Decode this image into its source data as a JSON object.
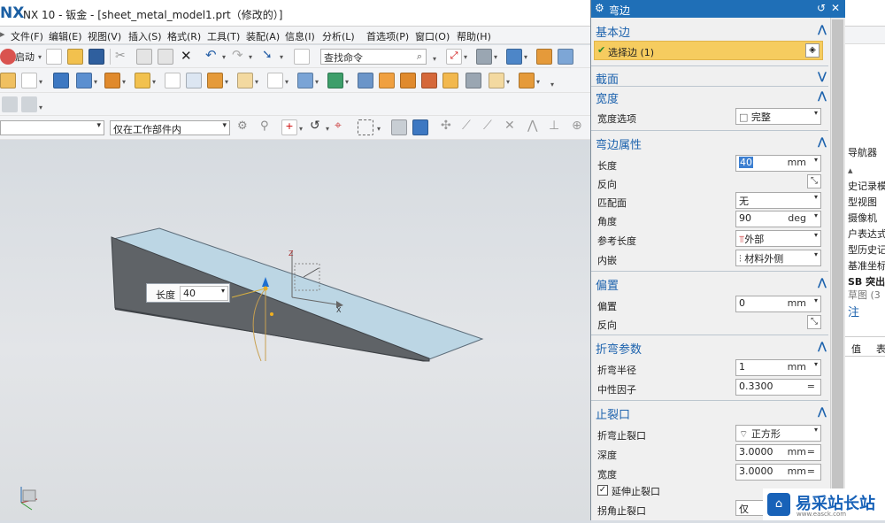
{
  "app": {
    "logo": "NX",
    "window_title": "NX 10 - 钣金 - [sheet_metal_model1.prt（修改的）]"
  },
  "menu": {
    "items": [
      "文件(F)",
      "编辑(E)",
      "视图(V)",
      "插入(S)",
      "格式(R)",
      "工具(T)",
      "装配(A)",
      "信息(I)",
      "分析(L)",
      "首选项(P)",
      "窗口(O)",
      "帮助(H)"
    ]
  },
  "toolbar": {
    "start_label": "启动",
    "search_placeholder": "查找命令",
    "filter_select": "",
    "scope_select": "仅在工作部件内"
  },
  "viewport": {
    "length_popup_label": "长度",
    "length_popup_value": "40",
    "axis_x": "X",
    "axis_z": "Z"
  },
  "dialog": {
    "title": "弯边",
    "sections": {
      "base_edge": {
        "title": "基本边",
        "select_label": "选择边 (1)"
      },
      "profile": {
        "title": "截面"
      },
      "width": {
        "title": "宽度",
        "width_option_label": "宽度选项",
        "width_option_value": "完整"
      },
      "flange_props": {
        "title": "弯边属性",
        "length_label": "长度",
        "length_value": "40",
        "length_unit": "mm",
        "reverse_label": "反向",
        "match_face_label": "匹配面",
        "match_face_value": "无",
        "angle_label": "角度",
        "angle_value": "90",
        "angle_unit": "deg",
        "ref_length_label": "参考长度",
        "ref_length_value": "外部",
        "inset_label": "内嵌",
        "inset_value": "材料外侧"
      },
      "offset": {
        "title": "偏置",
        "offset_label": "偏置",
        "offset_value": "0",
        "offset_unit": "mm",
        "reverse_label": "反向"
      },
      "bend_params": {
        "title": "折弯参数",
        "radius_label": "折弯半径",
        "radius_value": "1",
        "radius_unit": "mm",
        "neutral_label": "中性因子",
        "neutral_value": "0.3300"
      },
      "relief": {
        "title": "止裂口",
        "bend_relief_label": "折弯止裂口",
        "bend_relief_value": "正方形",
        "depth_label": "深度",
        "depth_value": "3.0000",
        "depth_unit": "mm",
        "width_label": "宽度",
        "width_value": "3.0000",
        "width_unit": "mm",
        "extend_label": "延伸止裂口",
        "corner_relief_label": "拐角止裂口",
        "corner_relief_value": "仅"
      }
    }
  },
  "right_nav": {
    "title": "导航器",
    "items": [
      "史记录模",
      "型视图",
      "摄像机",
      "户表达式",
      "型历史记",
      "基准坐标",
      "SB 突出",
      "草图 (3"
    ],
    "link": "注",
    "col_value": "值",
    "col_table": "表"
  },
  "watermark": {
    "text": "易采站长站",
    "url": "www.easck.com"
  }
}
